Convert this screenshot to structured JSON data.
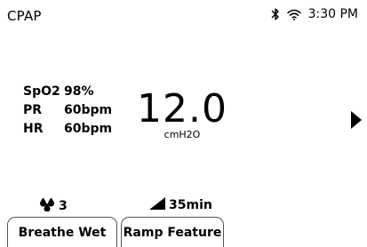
{
  "status_bar": {
    "title": "CPAP",
    "time": "3:30 PM",
    "icons": [
      "bluetooth-icon",
      "wifi-icon"
    ]
  },
  "vitals": [
    {
      "label": "SpO2",
      "value": "98%"
    },
    {
      "label": "PR",
      "value": "60bpm"
    },
    {
      "label": "HR",
      "value": "60bpm"
    }
  ],
  "pressure": {
    "value": "12.0",
    "unit": "cmH2O"
  },
  "indicators": {
    "humidity": {
      "icon": "water-drops-icon",
      "value": "3"
    },
    "ramp": {
      "icon": "ramp-icon",
      "value": "35min"
    }
  },
  "buttons": {
    "breathe_wet": "Breathe Wet",
    "ramp_feature": "Ramp Feature"
  },
  "navigation": {
    "next_icon": "play-arrow-right-icon"
  }
}
